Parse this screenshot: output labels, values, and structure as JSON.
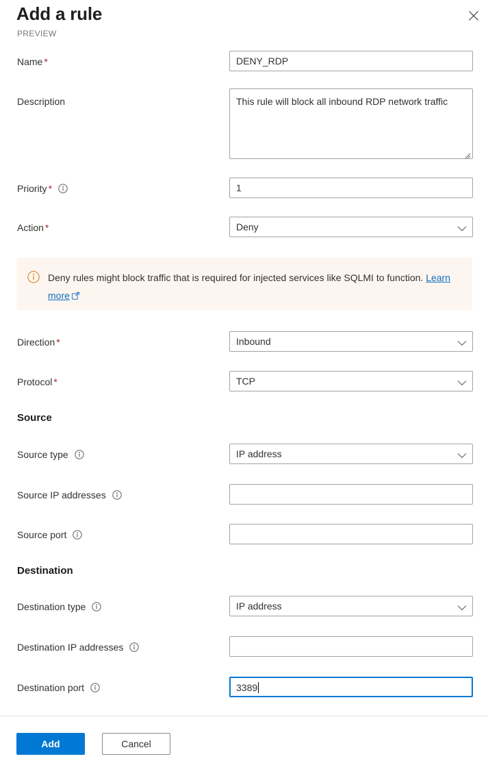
{
  "header": {
    "title": "Add a rule",
    "preview_label": "PREVIEW",
    "close_icon": "close-icon"
  },
  "form": {
    "name": {
      "label": "Name",
      "required": true,
      "value": "DENY_RDP"
    },
    "description": {
      "label": "Description",
      "required": false,
      "value": "This rule will block all inbound RDP network traffic"
    },
    "priority": {
      "label": "Priority",
      "required": true,
      "has_info": true,
      "value": "1"
    },
    "action": {
      "label": "Action",
      "required": true,
      "value": "Deny"
    },
    "direction": {
      "label": "Direction",
      "required": true,
      "value": "Inbound"
    },
    "protocol": {
      "label": "Protocol",
      "required": true,
      "value": "TCP"
    },
    "source_type": {
      "label": "Source type",
      "has_info": true,
      "value": "IP address"
    },
    "source_ip": {
      "label": "Source IP addresses",
      "has_info": true,
      "value": "",
      "placeholder": ""
    },
    "source_port": {
      "label": "Source port",
      "has_info": true,
      "value": "",
      "placeholder": ""
    },
    "destination_type": {
      "label": "Destination type",
      "has_info": true,
      "value": "IP address"
    },
    "destination_ip": {
      "label": "Destination IP addresses",
      "has_info": true,
      "value": "",
      "placeholder": ""
    },
    "destination_port": {
      "label": "Destination port",
      "has_info": true,
      "value": "3389",
      "focused": true
    }
  },
  "sections": {
    "source": "Source",
    "destination": "Destination"
  },
  "banner": {
    "icon": "info-circle-icon",
    "text": "Deny rules might block traffic that is required for injected services like SQLMI to function.",
    "link_label": "Learn more",
    "link_icon": "external-link-icon"
  },
  "footer": {
    "add_label": "Add",
    "cancel_label": "Cancel"
  },
  "colors": {
    "accent": "#0078d4",
    "required_asterisk": "#a4262c",
    "banner_bg": "#fdf6f0",
    "banner_icon": "#d8811a",
    "link": "#0f6cbd",
    "field_border": "#a2a2a2"
  }
}
